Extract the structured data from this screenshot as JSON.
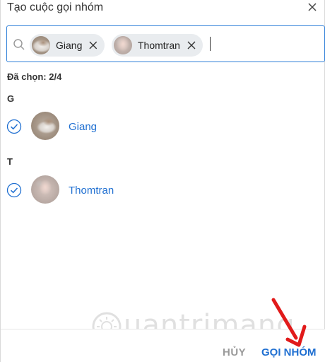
{
  "dialog": {
    "title": "Tạo cuộc gọi nhóm"
  },
  "search": {
    "chips": [
      {
        "label": "Giang"
      },
      {
        "label": "Thomtran"
      }
    ]
  },
  "selection": {
    "count_label": "Đã chọn:  2/4"
  },
  "groups": [
    {
      "letter": "G",
      "contacts": [
        {
          "name": "Giang",
          "checked": true
        }
      ]
    },
    {
      "letter": "T",
      "contacts": [
        {
          "name": "Thomtran",
          "checked": true
        }
      ]
    }
  ],
  "footer": {
    "cancel_label": "HỦY",
    "call_label": "GỌI NHÓM"
  },
  "watermark": {
    "text": "uantrimang"
  },
  "colors": {
    "accent": "#1f6fd1",
    "arrow": "#e11a1a"
  }
}
